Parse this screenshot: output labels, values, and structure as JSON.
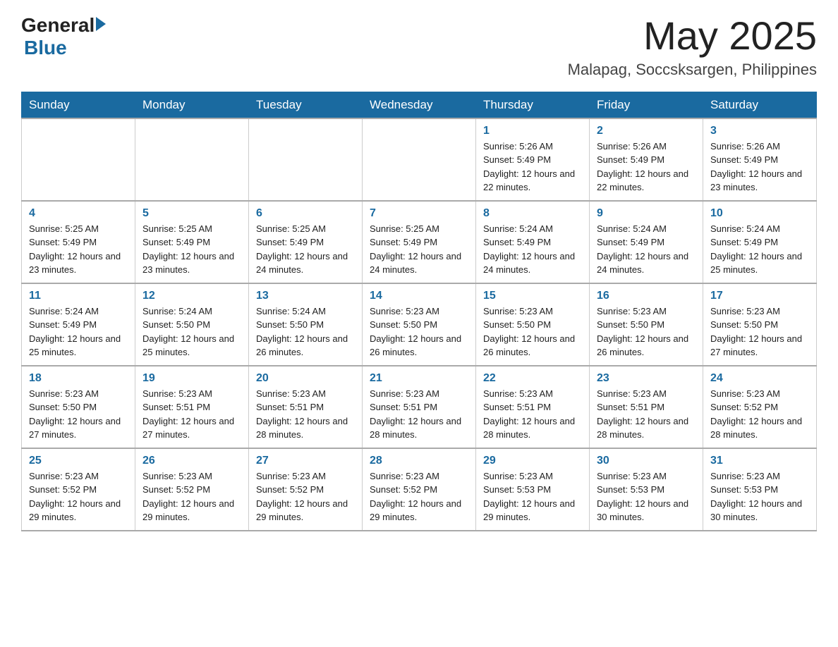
{
  "header": {
    "logo_general": "General",
    "logo_blue": "Blue",
    "month_title": "May 2025",
    "location": "Malapag, Soccsksargen, Philippines"
  },
  "days_of_week": [
    "Sunday",
    "Monday",
    "Tuesday",
    "Wednesday",
    "Thursday",
    "Friday",
    "Saturday"
  ],
  "weeks": [
    [
      {
        "day": "",
        "info": ""
      },
      {
        "day": "",
        "info": ""
      },
      {
        "day": "",
        "info": ""
      },
      {
        "day": "",
        "info": ""
      },
      {
        "day": "1",
        "info": "Sunrise: 5:26 AM\nSunset: 5:49 PM\nDaylight: 12 hours and 22 minutes."
      },
      {
        "day": "2",
        "info": "Sunrise: 5:26 AM\nSunset: 5:49 PM\nDaylight: 12 hours and 22 minutes."
      },
      {
        "day": "3",
        "info": "Sunrise: 5:26 AM\nSunset: 5:49 PM\nDaylight: 12 hours and 23 minutes."
      }
    ],
    [
      {
        "day": "4",
        "info": "Sunrise: 5:25 AM\nSunset: 5:49 PM\nDaylight: 12 hours and 23 minutes."
      },
      {
        "day": "5",
        "info": "Sunrise: 5:25 AM\nSunset: 5:49 PM\nDaylight: 12 hours and 23 minutes."
      },
      {
        "day": "6",
        "info": "Sunrise: 5:25 AM\nSunset: 5:49 PM\nDaylight: 12 hours and 24 minutes."
      },
      {
        "day": "7",
        "info": "Sunrise: 5:25 AM\nSunset: 5:49 PM\nDaylight: 12 hours and 24 minutes."
      },
      {
        "day": "8",
        "info": "Sunrise: 5:24 AM\nSunset: 5:49 PM\nDaylight: 12 hours and 24 minutes."
      },
      {
        "day": "9",
        "info": "Sunrise: 5:24 AM\nSunset: 5:49 PM\nDaylight: 12 hours and 24 minutes."
      },
      {
        "day": "10",
        "info": "Sunrise: 5:24 AM\nSunset: 5:49 PM\nDaylight: 12 hours and 25 minutes."
      }
    ],
    [
      {
        "day": "11",
        "info": "Sunrise: 5:24 AM\nSunset: 5:49 PM\nDaylight: 12 hours and 25 minutes."
      },
      {
        "day": "12",
        "info": "Sunrise: 5:24 AM\nSunset: 5:50 PM\nDaylight: 12 hours and 25 minutes."
      },
      {
        "day": "13",
        "info": "Sunrise: 5:24 AM\nSunset: 5:50 PM\nDaylight: 12 hours and 26 minutes."
      },
      {
        "day": "14",
        "info": "Sunrise: 5:23 AM\nSunset: 5:50 PM\nDaylight: 12 hours and 26 minutes."
      },
      {
        "day": "15",
        "info": "Sunrise: 5:23 AM\nSunset: 5:50 PM\nDaylight: 12 hours and 26 minutes."
      },
      {
        "day": "16",
        "info": "Sunrise: 5:23 AM\nSunset: 5:50 PM\nDaylight: 12 hours and 26 minutes."
      },
      {
        "day": "17",
        "info": "Sunrise: 5:23 AM\nSunset: 5:50 PM\nDaylight: 12 hours and 27 minutes."
      }
    ],
    [
      {
        "day": "18",
        "info": "Sunrise: 5:23 AM\nSunset: 5:50 PM\nDaylight: 12 hours and 27 minutes."
      },
      {
        "day": "19",
        "info": "Sunrise: 5:23 AM\nSunset: 5:51 PM\nDaylight: 12 hours and 27 minutes."
      },
      {
        "day": "20",
        "info": "Sunrise: 5:23 AM\nSunset: 5:51 PM\nDaylight: 12 hours and 28 minutes."
      },
      {
        "day": "21",
        "info": "Sunrise: 5:23 AM\nSunset: 5:51 PM\nDaylight: 12 hours and 28 minutes."
      },
      {
        "day": "22",
        "info": "Sunrise: 5:23 AM\nSunset: 5:51 PM\nDaylight: 12 hours and 28 minutes."
      },
      {
        "day": "23",
        "info": "Sunrise: 5:23 AM\nSunset: 5:51 PM\nDaylight: 12 hours and 28 minutes."
      },
      {
        "day": "24",
        "info": "Sunrise: 5:23 AM\nSunset: 5:52 PM\nDaylight: 12 hours and 28 minutes."
      }
    ],
    [
      {
        "day": "25",
        "info": "Sunrise: 5:23 AM\nSunset: 5:52 PM\nDaylight: 12 hours and 29 minutes."
      },
      {
        "day": "26",
        "info": "Sunrise: 5:23 AM\nSunset: 5:52 PM\nDaylight: 12 hours and 29 minutes."
      },
      {
        "day": "27",
        "info": "Sunrise: 5:23 AM\nSunset: 5:52 PM\nDaylight: 12 hours and 29 minutes."
      },
      {
        "day": "28",
        "info": "Sunrise: 5:23 AM\nSunset: 5:52 PM\nDaylight: 12 hours and 29 minutes."
      },
      {
        "day": "29",
        "info": "Sunrise: 5:23 AM\nSunset: 5:53 PM\nDaylight: 12 hours and 29 minutes."
      },
      {
        "day": "30",
        "info": "Sunrise: 5:23 AM\nSunset: 5:53 PM\nDaylight: 12 hours and 30 minutes."
      },
      {
        "day": "31",
        "info": "Sunrise: 5:23 AM\nSunset: 5:53 PM\nDaylight: 12 hours and 30 minutes."
      }
    ]
  ]
}
